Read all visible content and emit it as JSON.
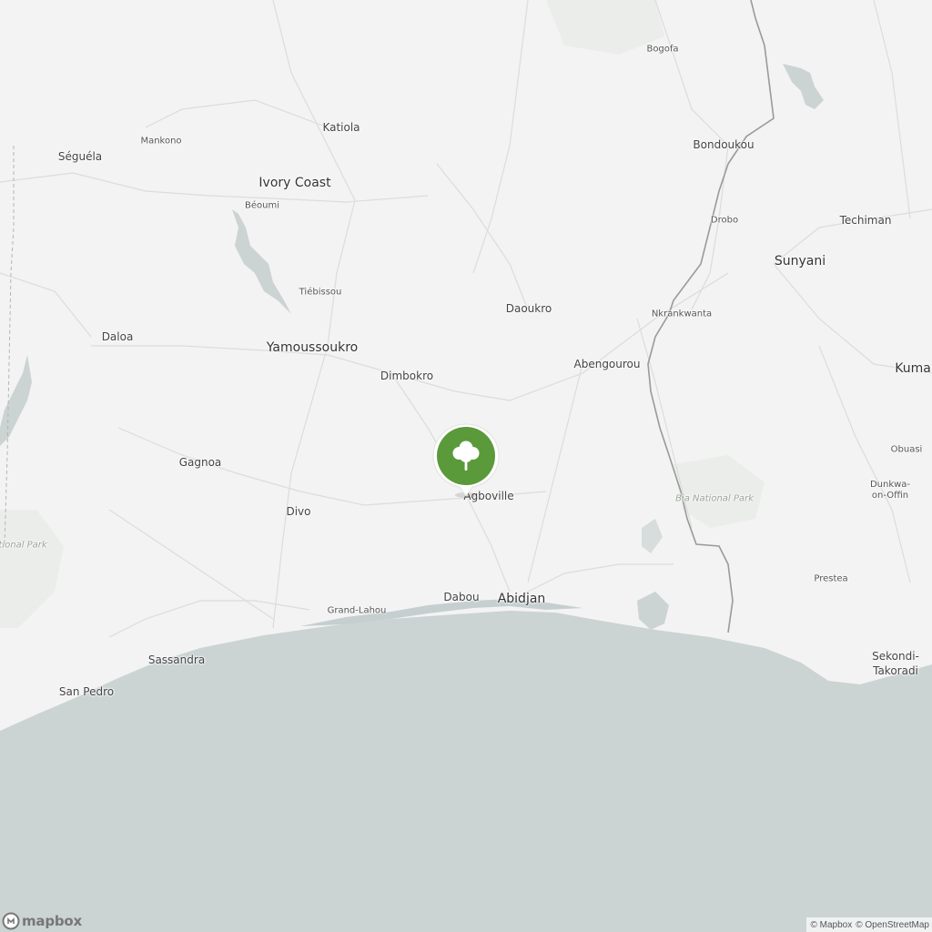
{
  "map": {
    "colors": {
      "land": "#f2f3f2",
      "water": "#cbd3d3",
      "border": "#9a9a9a",
      "road": "#dcdcdc",
      "marker": "#5a9a3a"
    },
    "labels": {
      "bogofa": "Bogofa",
      "katiola": "Katiola",
      "mankono": "Mankono",
      "seguela": "Séguéla",
      "bondoukou": "Bondoukou",
      "ivory_coast": "Ivory Coast",
      "beoumi": "Béoumi",
      "drobo": "Drobo",
      "techiman": "Techiman",
      "sunyani": "Sunyani",
      "tiebissou": "Tiébissou",
      "daoukro": "Daoukro",
      "nkrankwanta": "Nkrankwanta",
      "daloa": "Daloa",
      "yamoussoukro": "Yamoussoukro",
      "dimbokro": "Dimbokro",
      "abengourou": "Abengourou",
      "kumasi": "Kuma",
      "obuasi": "Obuasi",
      "gagnoa": "Gagnoa",
      "agboville": "Agboville",
      "bia_park": "Bi̇a National Park",
      "dunkwa": "Dunkwa-on-Offin",
      "takoradi": "Sekondi-Takoradi",
      "divo": "Divo",
      "national_park_left": "ational Park",
      "prestea": "Prestea",
      "grand_lahou": "Grand-Lahou",
      "dabou": "Dabou",
      "abidjan": "Abidjan",
      "sassandra": "Sassandra",
      "san_pedro": "San Pedro"
    },
    "marker_icon": "tree-icon"
  },
  "branding": {
    "logo": "mapbox",
    "logo_icon": "mapbox-logo-icon"
  },
  "attribution": {
    "mapbox": "© Mapbox",
    "osm": "© OpenStreetMap"
  }
}
